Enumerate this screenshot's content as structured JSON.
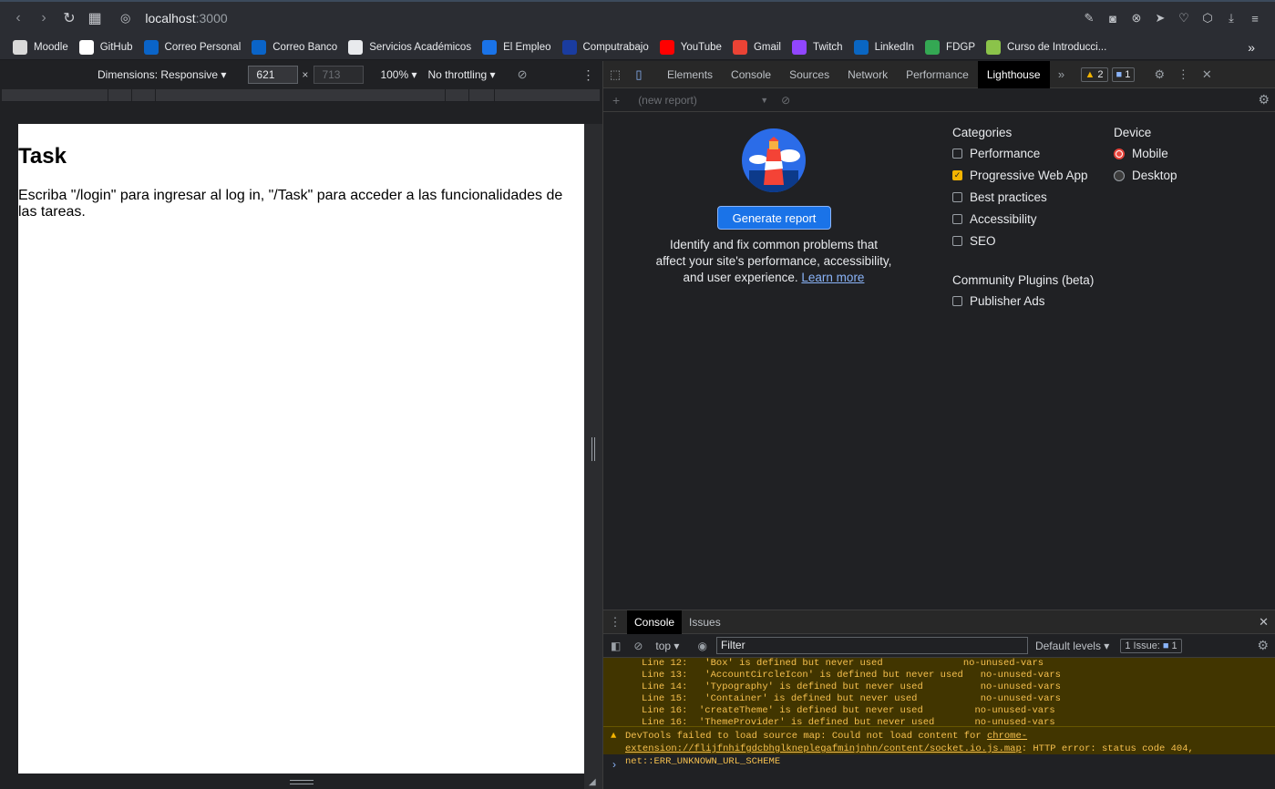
{
  "browser": {
    "url_host": "localhost",
    "url_port": ":3000",
    "bookmarks": [
      {
        "label": "Moodle",
        "color": "#d9d9d9"
      },
      {
        "label": "GitHub",
        "color": "#ffffff"
      },
      {
        "label": "Correo Personal",
        "color": "#0a64c8"
      },
      {
        "label": "Correo Banco",
        "color": "#0a64c8"
      },
      {
        "label": "Servicios Académicos",
        "color": "#e8eaed"
      },
      {
        "label": "El Empleo",
        "color": "#1a73e8"
      },
      {
        "label": "Computrabajo",
        "color": "#1a3ca0"
      },
      {
        "label": "YouTube",
        "color": "#ff0000"
      },
      {
        "label": "Gmail",
        "color": "#ea4335"
      },
      {
        "label": "Twitch",
        "color": "#9146ff"
      },
      {
        "label": "LinkedIn",
        "color": "#0a66c2"
      },
      {
        "label": "FDGP",
        "color": "#34a853"
      },
      {
        "label": "Curso de Introducci...",
        "color": "#8bc34a"
      }
    ]
  },
  "device_toolbar": {
    "dimensions_label": "Dimensions: Responsive ▾",
    "width": "621",
    "height": "713",
    "times": "×",
    "zoom": "100% ▾",
    "throttling": "No throttling ▾"
  },
  "page": {
    "title": "Task",
    "text": "Escriba \"/login\" para ingresar al log in, \"/Task\" para acceder a las funcionalidades de las tareas."
  },
  "devtools": {
    "tabs": [
      "Elements",
      "Console",
      "Sources",
      "Network",
      "Performance",
      "Lighthouse"
    ],
    "selected_tab": "Lighthouse",
    "more": "»",
    "warnings_count": "2",
    "messages_count": "1",
    "report_select": "(new report)",
    "generate_button": "Generate report",
    "description": "Identify and fix common problems that affect your site's performance, accessibility, and user experience.",
    "learn_more": "Learn more",
    "categories_heading": "Categories",
    "categories": [
      {
        "label": "Performance",
        "checked": false
      },
      {
        "label": "Progressive Web App",
        "checked": true
      },
      {
        "label": "Best practices",
        "checked": false
      },
      {
        "label": "Accessibility",
        "checked": false
      },
      {
        "label": "SEO",
        "checked": false
      }
    ],
    "device_heading": "Device",
    "devices": [
      {
        "label": "Mobile",
        "selected": true
      },
      {
        "label": "Desktop",
        "selected": false
      }
    ],
    "plugins_heading": "Community Plugins (beta)",
    "plugins": [
      {
        "label": "Publisher Ads",
        "checked": false
      }
    ]
  },
  "drawer": {
    "tabs": [
      "Console",
      "Issues"
    ],
    "context": "top ▾",
    "filter_placeholder": "Filter",
    "levels": "Default levels ▾",
    "issues_label": "1 Issue:",
    "issues_count": "1",
    "warning_lines": [
      "Line 12:   'Box' is defined but never used              no-unused-vars",
      "Line 13:   'AccountCircleIcon' is defined but never used   no-unused-vars",
      "Line 14:   'Typography' is defined but never used          no-unused-vars",
      "Line 15:   'Container' is defined but never used           no-unused-vars",
      "Line 16:  'createTheme' is defined but never used         no-unused-vars",
      "Line 16:  'ThemeProvider' is defined but never used       no-unused-vars"
    ],
    "error_prefix": "DevTools failed to load source map: Could not load content for ",
    "error_link": "chrome-extension://flijfnhifgdcbhglkneplegafminjnhn/content/socket.io.js.map",
    "error_suffix": ": HTTP error: status code 404, net::ERR_UNKNOWN_URL_SCHEME",
    "prompt": "›"
  }
}
